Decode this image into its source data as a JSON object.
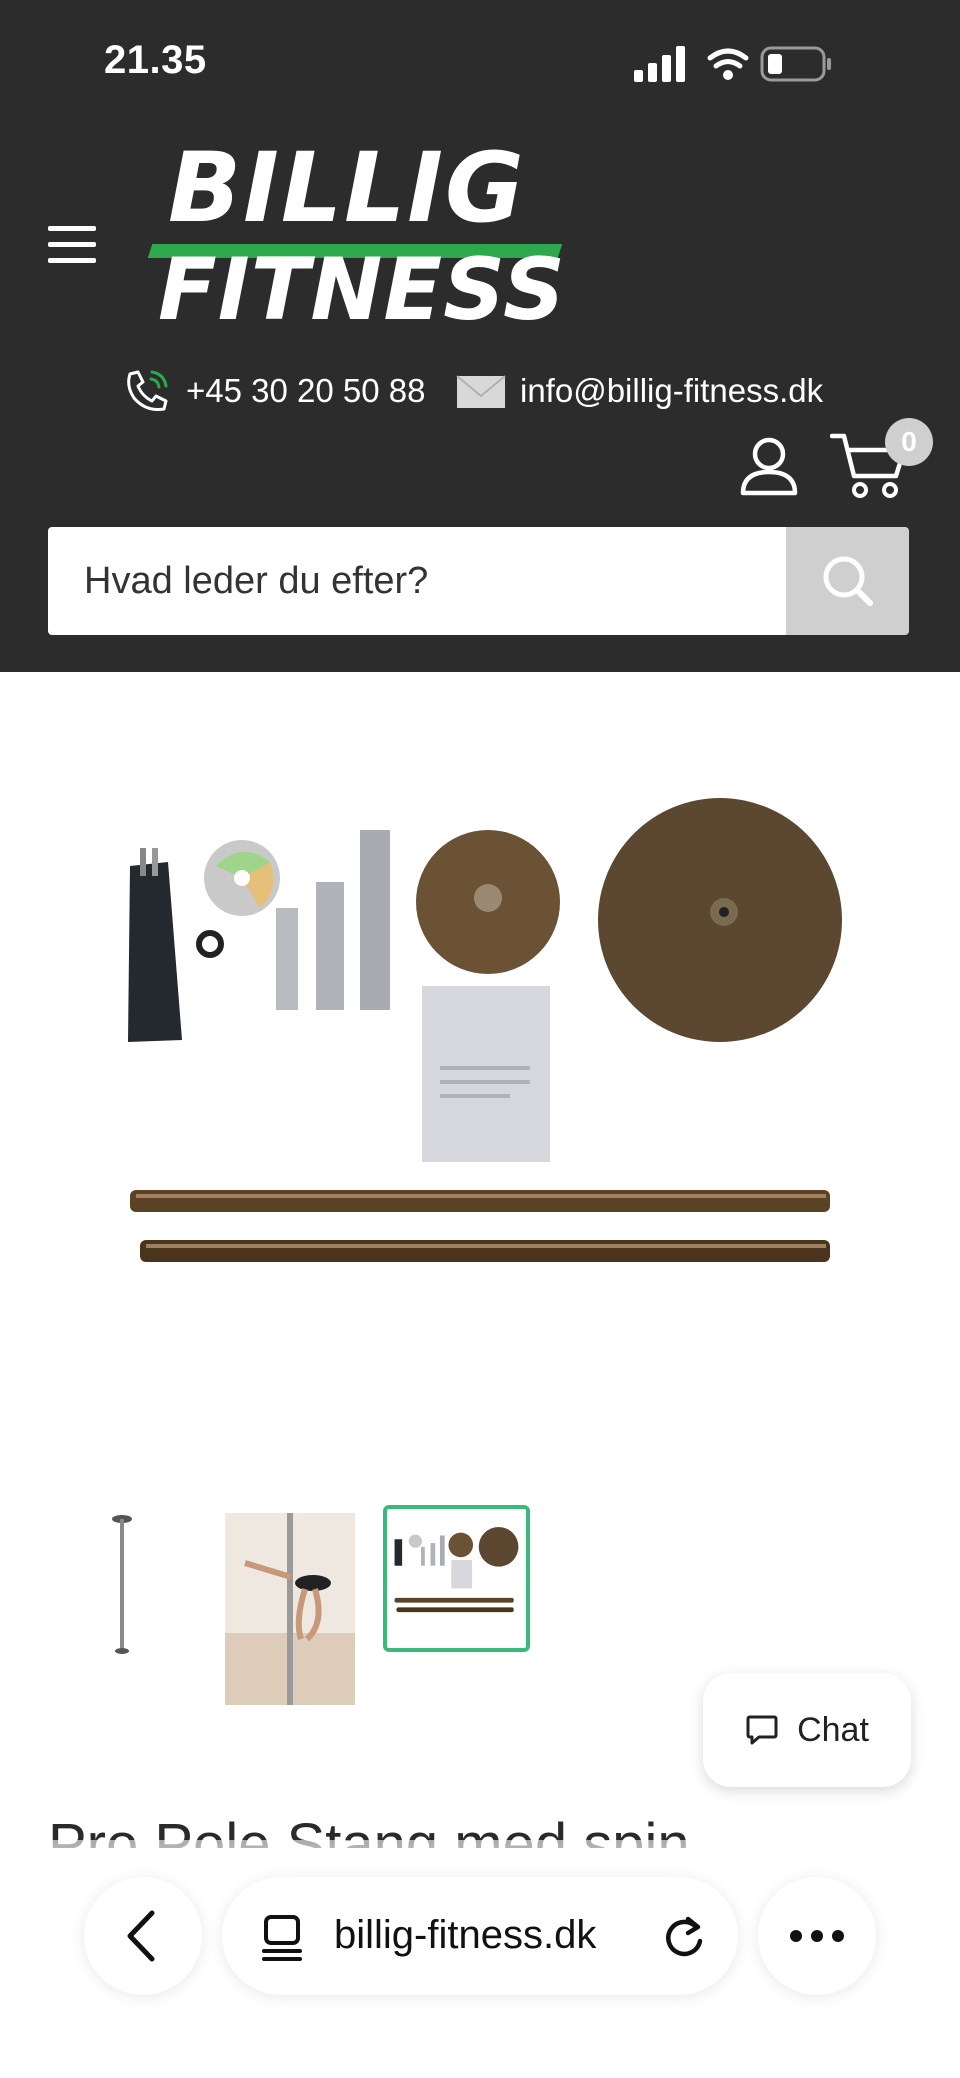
{
  "status_bar": {
    "time": "21.35"
  },
  "header": {
    "logo_line1": "BILLIG",
    "logo_line2": "FITNESS",
    "phone": "+45 30 20 50 88",
    "email": "info@billig-fitness.dk",
    "cart_count": "0",
    "brand_green": "#2ea84d",
    "background": "#2c2c2c"
  },
  "search": {
    "placeholder": "Hvad leder du efter?"
  },
  "chat": {
    "label": "Chat"
  },
  "product": {
    "title": "Pro Pole Stang med spin"
  },
  "browser": {
    "url": "billig-fitness.dk"
  },
  "icons": [
    "menu-icon",
    "phone-icon",
    "mail-icon",
    "account-icon",
    "cart-icon",
    "search-icon",
    "chat-icon",
    "back-icon",
    "tabs-icon",
    "reload-icon",
    "more-icon"
  ]
}
